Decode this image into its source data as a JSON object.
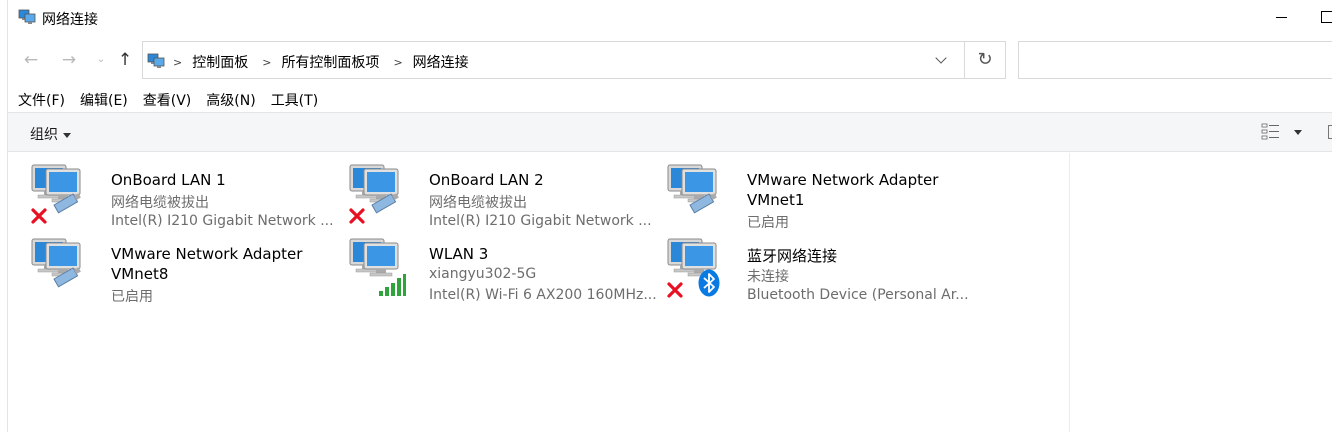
{
  "window": {
    "title": "网络连接"
  },
  "nav": {
    "back_glyph": "←",
    "forward_glyph": "→",
    "dropdown_glyph": "⌄",
    "up_glyph": "↑",
    "refresh_glyph": "↻",
    "breadcrumbs": [
      "控制面板",
      "所有控制面板项",
      "网络连接"
    ],
    "search_placeholder": ""
  },
  "menu": [
    "文件(F)",
    "编辑(E)",
    "查看(V)",
    "高级(N)",
    "工具(T)"
  ],
  "toolbar": {
    "organize_label": "组织"
  },
  "adapters": [
    {
      "name": "OnBoard LAN 1",
      "line2": "网络电缆被拔出",
      "line3": "Intel(R) I210 Gigabit Network ...",
      "type": "ethernet",
      "status_icon": "red-x-icon"
    },
    {
      "name": "OnBoard LAN 2",
      "line2": "网络电缆被拔出",
      "line3": "Intel(R) I210 Gigabit Network ...",
      "type": "ethernet",
      "status_icon": "red-x-icon"
    },
    {
      "name": "VMware Network Adapter",
      "line2": "VMnet1",
      "line3": "已启用",
      "type": "ethernet",
      "status_icon": "none"
    },
    {
      "name": "VMware Network Adapter",
      "line2": "VMnet8",
      "line3": "已启用",
      "type": "ethernet",
      "status_icon": "none"
    },
    {
      "name": "WLAN 3",
      "line2": "xiangyu302-5G",
      "line3": "Intel(R) Wi-Fi 6 AX200 160MHz...",
      "type": "wifi",
      "status_icon": "signal-bars-icon"
    },
    {
      "name": "蓝牙网络连接",
      "line2": "未连接",
      "line3": "Bluetooth Device (Personal Ar...",
      "type": "bluetooth",
      "status_icon": "red-x-icon"
    }
  ],
  "colors": {
    "monitor_blue": "#2b87d8",
    "error_red": "#e81123",
    "bluetooth_blue": "#0a7ae3",
    "signal_green": "#2fa43a",
    "secondary_text": "#6d6d6d"
  }
}
